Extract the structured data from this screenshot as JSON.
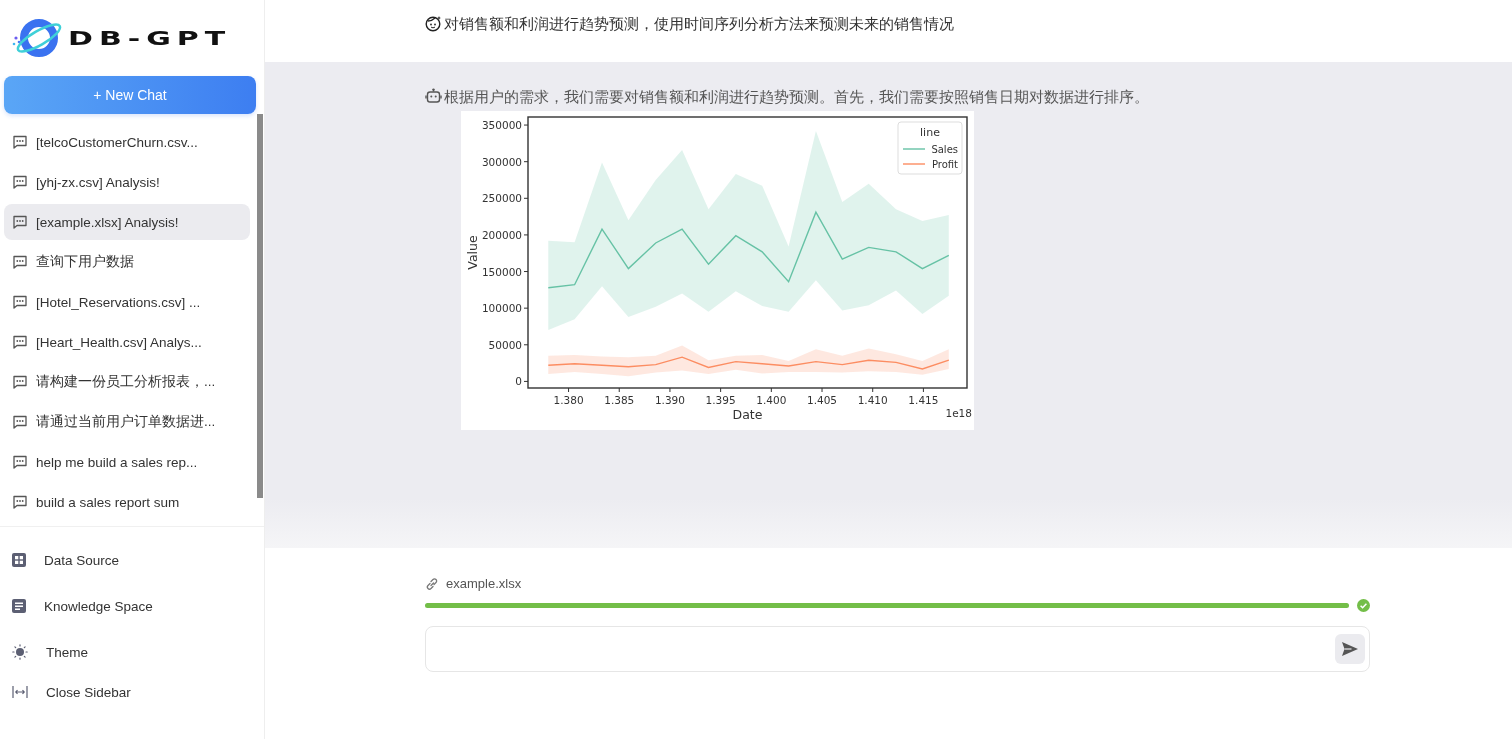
{
  "sidebar": {
    "logo": {
      "text": "DB-GPT"
    },
    "new_chat_button": "+ New Chat",
    "chats": [
      {
        "title": "[telcoCustomerChurn.csv...",
        "selected": false
      },
      {
        "title": "[yhj-zx.csv] Analysis!",
        "selected": false
      },
      {
        "title": "[example.xlsx] Analysis!",
        "selected": true
      },
      {
        "title": "查询下用户数据",
        "selected": false
      },
      {
        "title": "[Hotel_Reservations.csv] ...",
        "selected": false
      },
      {
        "title": "[Heart_Health.csv] Analys...",
        "selected": false
      },
      {
        "title": "请构建一份员工分析报表，...",
        "selected": false
      },
      {
        "title": "请通过当前用户订单数据进...",
        "selected": false
      },
      {
        "title": "help me build a sales rep...",
        "selected": false
      },
      {
        "title": "build a sales report sum",
        "selected": false
      }
    ],
    "menu": [
      {
        "label": "Data Source"
      },
      {
        "label": "Knowledge Space"
      },
      {
        "label": "Theme"
      },
      {
        "label": "Close Sidebar"
      }
    ]
  },
  "messages": [
    {
      "kind": "user",
      "text": "对销售额和利润进行趋势预测，使用时间序列分析方法来预测未来的销售情况"
    },
    {
      "kind": "assistant",
      "text": "根据用户的需求，我们需要对销售额和利润进行趋势预测。首先，我们需要按照销售日期对数据进行排序。",
      "chart_data": {
        "type": "line",
        "xlabel": "Date",
        "ylabel": "Value",
        "annotations": [
          {
            "text": "1e18"
          }
        ],
        "legend": {
          "title": "line"
        },
        "x": [
          1.378,
          1.3806,
          1.3833,
          1.3859,
          1.3886,
          1.3912,
          1.3938,
          1.3965,
          1.3991,
          1.4017,
          1.4044,
          1.407,
          1.4096,
          1.4123,
          1.4149,
          1.4175
        ],
        "series": [
          {
            "name": "Sales",
            "color": "#66c2a5",
            "values": [
              128000,
              132000,
              208000,
              154000,
              189000,
              208000,
              160000,
              199000,
              177000,
              136000,
              231000,
              167000,
              183000,
              177000,
              154000,
              172000
            ],
            "upper": [
              192000,
              190000,
              299000,
              220000,
              275000,
              316000,
              235000,
              283000,
              267000,
              184000,
              342000,
              245000,
              270000,
              235000,
              219000,
              227000
            ],
            "lower": [
              70000,
              85000,
              130000,
              88000,
              102000,
              120000,
              95000,
              123000,
              103000,
              95000,
              138000,
              97000,
              104000,
              124000,
              92000,
              117000
            ]
          },
          {
            "name": "Profit",
            "color": "#fc8d62",
            "values": [
              22000,
              24000,
              22000,
              20000,
              23000,
              33000,
              19000,
              27000,
              24000,
              21000,
              27000,
              23000,
              29000,
              26000,
              17000,
              29000
            ],
            "upper": [
              35000,
              36000,
              34000,
              33000,
              35000,
              49000,
              29000,
              35000,
              36000,
              28000,
              44000,
              35000,
              45000,
              37000,
              28000,
              44000
            ],
            "lower": [
              10000,
              13000,
              10000,
              7000,
              12000,
              15000,
              10000,
              16000,
              11000,
              13000,
              13000,
              12000,
              14000,
              13000,
              9000,
              17000
            ]
          }
        ],
        "xlim": [
          1.376,
          1.4193
        ],
        "ylim": [
          -9000,
          361000
        ],
        "xticks": [
          {
            "value": 1.38,
            "label": "1.380"
          },
          {
            "value": 1.385,
            "label": "1.385"
          },
          {
            "value": 1.39,
            "label": "1.390"
          },
          {
            "value": 1.395,
            "label": "1.395"
          },
          {
            "value": 1.4,
            "label": "1.400"
          },
          {
            "value": 1.405,
            "label": "1.405"
          },
          {
            "value": 1.41,
            "label": "1.410"
          },
          {
            "value": 1.415,
            "label": "1.415"
          }
        ],
        "yticks": [
          0,
          50000,
          100000,
          150000,
          200000,
          250000,
          300000,
          350000
        ]
      }
    }
  ],
  "composer": {
    "attachment": {
      "file_name": "example.xlsx",
      "level": 1,
      "done": true
    }
  }
}
